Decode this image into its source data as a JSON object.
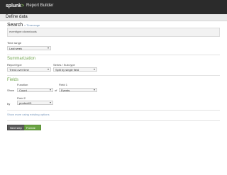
{
  "app": {
    "logo_text": "splunk",
    "logo_arrow": ">",
    "title": "Report Builder"
  },
  "subbar": {
    "title": "Define data"
  },
  "search": {
    "heading": "Search",
    "link": "« Timerange",
    "query": "eventtype=downloads"
  },
  "time_range": {
    "label": "Time range",
    "value": "Last week"
  },
  "summarization": {
    "heading": "Summarization",
    "report_type_label": "Report type",
    "report_type_value": "Trend over time",
    "series_label": "Series / Sub-type",
    "series_value": "Split by single field"
  },
  "fields": {
    "heading": "Fields",
    "function_label": "Function",
    "field1_label": "Field 1",
    "show_label": "Show",
    "function_value": "Count",
    "of_label": "of",
    "field1_value": "Events",
    "field2_label": "Field 2",
    "by_label": "by",
    "field2_value": "productID"
  },
  "links": {
    "more_options": "Show more using existing options"
  },
  "buttons": {
    "next_label": "Next step",
    "format_label": "Format report"
  },
  "colors": {
    "accent_green": "#73a550",
    "topbar": "#2b2b2b",
    "link_blue": "#6b8db3"
  }
}
